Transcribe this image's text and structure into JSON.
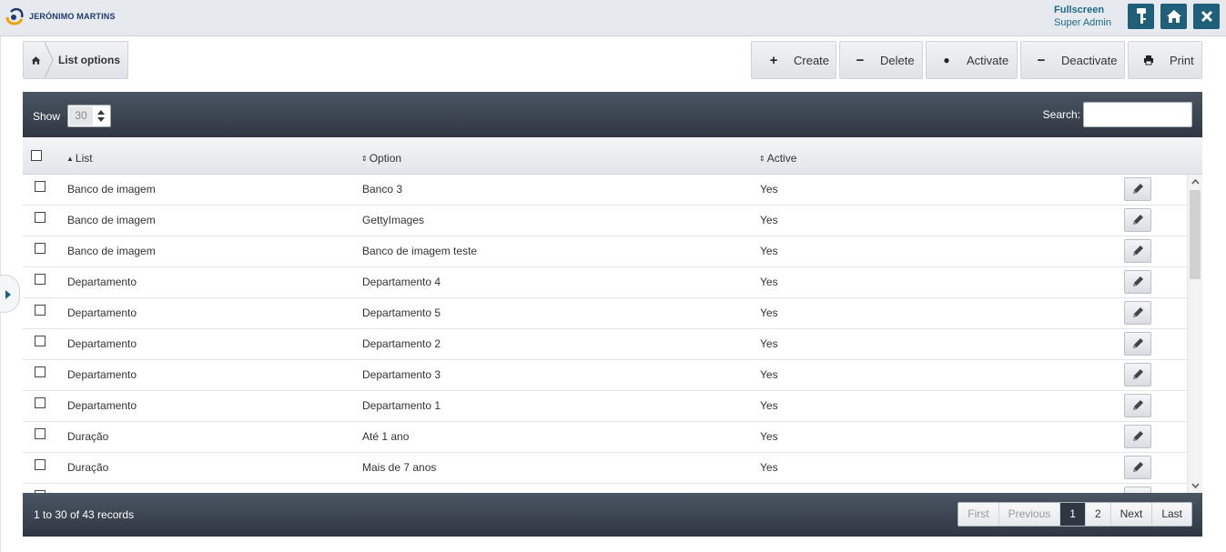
{
  "header": {
    "logo_text": "JERÓNIMO MARTINS",
    "fullscreen_label": "Fullscreen",
    "user_role": "Super Admin",
    "buttons": [
      {
        "name": "key-button",
        "icon": "key-icon"
      },
      {
        "name": "home-button",
        "icon": "home-icon"
      },
      {
        "name": "close-button",
        "icon": "close-icon"
      }
    ]
  },
  "breadcrumb": {
    "home_icon": "home-icon",
    "label": "List options"
  },
  "toolbar": {
    "create_label": "Create",
    "delete_label": "Delete",
    "activate_label": "Activate",
    "deactivate_label": "Deactivate",
    "print_label": "Print"
  },
  "table_controls": {
    "show_label": "Show",
    "show_value": "30",
    "search_label": "Search:",
    "search_value": ""
  },
  "columns": {
    "list": "List",
    "option": "Option",
    "active": "Active"
  },
  "rows": [
    {
      "list": "Banco de imagem",
      "option": "Banco 3",
      "active": "Yes"
    },
    {
      "list": "Banco de imagem",
      "option": "GettyImages",
      "active": "Yes"
    },
    {
      "list": "Banco de imagem",
      "option": "Banco de imagem teste",
      "active": "Yes"
    },
    {
      "list": "Departamento",
      "option": "Departamento 4",
      "active": "Yes"
    },
    {
      "list": "Departamento",
      "option": "Departamento 5",
      "active": "Yes"
    },
    {
      "list": "Departamento",
      "option": "Departamento 2",
      "active": "Yes"
    },
    {
      "list": "Departamento",
      "option": "Departamento 3",
      "active": "Yes"
    },
    {
      "list": "Departamento",
      "option": "Departamento 1",
      "active": "Yes"
    },
    {
      "list": "Duração",
      "option": "Até 1 ano",
      "active": "Yes"
    },
    {
      "list": "Duração",
      "option": "Mais de 7 anos",
      "active": "Yes"
    }
  ],
  "footer": {
    "records_text": "1 to 30 of 43 records",
    "pager": {
      "first": "First",
      "previous": "Previous",
      "page_1": "1",
      "page_2": "2",
      "next": "Next",
      "last": "Last"
    }
  },
  "colors": {
    "accent": "#1f5f79",
    "panel_dark": "#2f3742"
  }
}
